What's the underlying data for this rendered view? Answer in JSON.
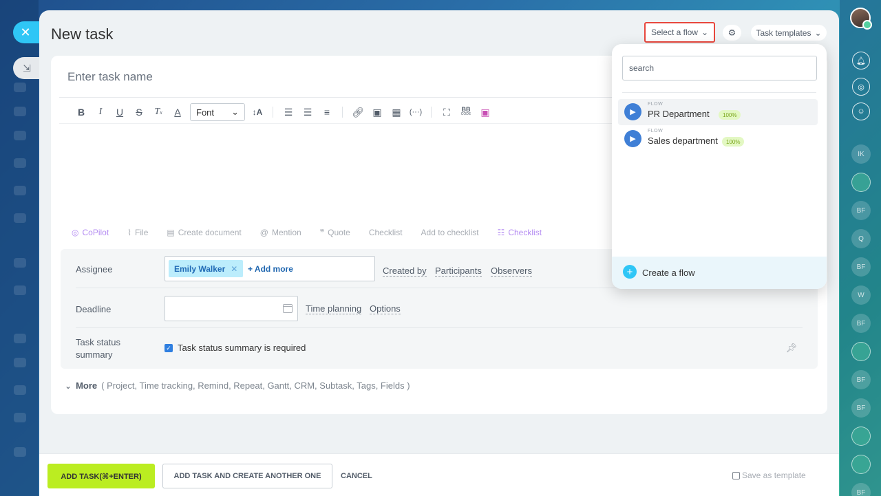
{
  "title": "New task",
  "header": {
    "flow_button": "Select a flow",
    "templates_button": "Task templates"
  },
  "editor": {
    "task_name_placeholder": "Enter task name",
    "font_select": "Font",
    "bbcode_top": "BB",
    "bbcode_bottom": "CODE"
  },
  "actions": [
    {
      "label": "CoPilot"
    },
    {
      "label": "File"
    },
    {
      "label": "Create document"
    },
    {
      "label": "Mention"
    },
    {
      "label": "Quote"
    },
    {
      "label": "Checklist"
    },
    {
      "label": "Add to checklist"
    },
    {
      "label": "Checklist"
    }
  ],
  "fields": {
    "assignee_label": "Assignee",
    "assignee_chip": "Emily Walker",
    "add_more": "+ Add more",
    "created_by": "Created by",
    "participants": "Participants",
    "observers": "Observers",
    "deadline_label": "Deadline",
    "time_planning": "Time planning",
    "options": "Options",
    "status_label_1": "Task status",
    "status_label_2": "summary",
    "status_required": "Task status summary is required"
  },
  "more": {
    "label": "More",
    "list": "( Project,  Time tracking,  Remind,  Repeat,  Gantt,  CRM,  Subtask,  Tags,  Fields )"
  },
  "footer": {
    "add_task": "ADD TASK(⌘+ENTER)",
    "add_another": "ADD TASK AND CREATE ANOTHER ONE",
    "cancel": "CANCEL",
    "save_template": "Save as template"
  },
  "flow_popup": {
    "search_value": "search",
    "items": [
      {
        "caption": "FLOW",
        "name": "PR Department",
        "badge": "100%"
      },
      {
        "caption": "FLOW",
        "name": "Sales department",
        "badge": "100%"
      }
    ],
    "create_label": "Create a flow"
  },
  "right_rail": {
    "circles": [
      "IK",
      "",
      "BF",
      "Q",
      "BF",
      "W",
      "BF",
      "",
      "BF",
      "BF",
      "",
      "",
      "BF"
    ]
  },
  "colors": {
    "accent_blue": "#2fc6f6",
    "add_task_green": "#bbed21",
    "highlight_red": "#e8473d"
  }
}
